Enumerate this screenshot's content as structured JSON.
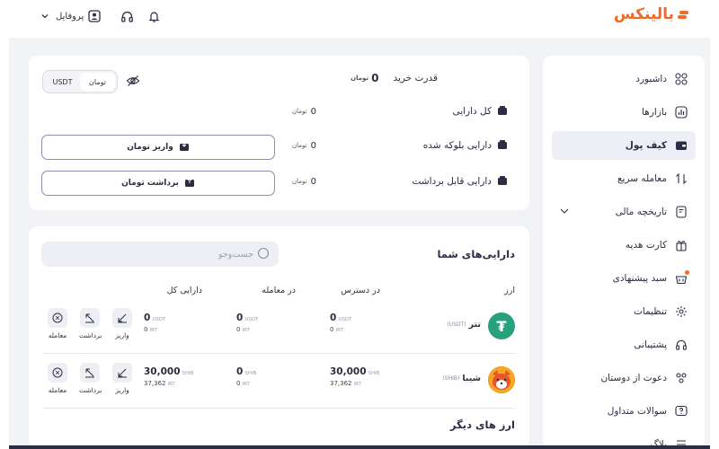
{
  "brand": {
    "logo_text": "بالینکس",
    "color": "#f06a2a"
  },
  "topbar": {
    "profile_label": "پروفایل",
    "icons": [
      "user-icon",
      "headphones-icon",
      "bell-icon",
      "chevron-down-icon"
    ]
  },
  "sidebar": {
    "items": [
      {
        "label": "داشبورد",
        "icon": "grid-icon"
      },
      {
        "label": "بازارها",
        "icon": "chart-icon"
      },
      {
        "label": "کیف پول",
        "icon": "wallet-icon",
        "active": true
      },
      {
        "label": "معامله سریع",
        "icon": "swap-icon"
      },
      {
        "label": "تاریخچه مالی",
        "icon": "history-icon"
      },
      {
        "label": "کارت هدیه",
        "icon": "gift-icon"
      },
      {
        "label": "سبد پیشنهادی",
        "icon": "basket-icon"
      },
      {
        "label": "تنظیمات",
        "icon": "gear-icon"
      },
      {
        "label": "پشتیبانی",
        "icon": "headphones-icon"
      },
      {
        "label": "دعوت از دوستان",
        "icon": "users-icon"
      },
      {
        "label": "سوالات متداول",
        "icon": "question-icon"
      },
      {
        "label": "بلاگ",
        "icon": "blog-icon"
      }
    ]
  },
  "balance": {
    "buy_power_label": "قدرت خرید",
    "buy_power_value": "0",
    "currency_unit": "تومان",
    "toggle": {
      "toman": "تومان",
      "usdt": "USDT",
      "selected": "تومان"
    },
    "rows": [
      {
        "label": "کل دارایی",
        "value": "0"
      },
      {
        "label": "دارایی بلوکه شده",
        "value": "0"
      },
      {
        "label": "دارایی قابل برداشت",
        "value": "0"
      }
    ],
    "deposit_button": "واریز تومان",
    "withdraw_button": "برداشت تومان"
  },
  "assets": {
    "title": "دارایی‌های شما",
    "search_placeholder": "جست‌وجو",
    "columns": {
      "coin": "ارز",
      "available": "در دسترس",
      "in_trade": "در معامله",
      "total": "دارایی کل"
    },
    "rows": [
      {
        "name": "تتر",
        "symbol": "(USDT)",
        "logo_color": "#26a17b",
        "logo_glyph": "₮",
        "available": {
          "main": "0",
          "main_unit": "USDT",
          "sub": "0",
          "sub_unit": "IRT"
        },
        "in_trade": {
          "main": "0",
          "main_unit": "USDT",
          "sub": "0",
          "sub_unit": "IRT"
        },
        "total": {
          "main": "0",
          "main_unit": "USDT",
          "sub": "0",
          "sub_unit": "IRT"
        }
      },
      {
        "name": "شیبا",
        "symbol": "(SHIB)",
        "logo_color": "#e8542b",
        "logo_glyph": "🐕",
        "available": {
          "main": "30,000",
          "main_unit": "SHIB",
          "sub": "37,362",
          "sub_unit": "IRT"
        },
        "in_trade": {
          "main": "0",
          "main_unit": "SHIB",
          "sub": "0",
          "sub_unit": "IRT"
        },
        "total": {
          "main": "30,000",
          "main_unit": "SHIB",
          "sub": "37,362",
          "sub_unit": "IRT"
        }
      }
    ],
    "row_actions": {
      "deposit": "واریز",
      "withdraw": "برداشت",
      "trade": "معامله"
    },
    "other_title": "ارز های دیگر"
  }
}
